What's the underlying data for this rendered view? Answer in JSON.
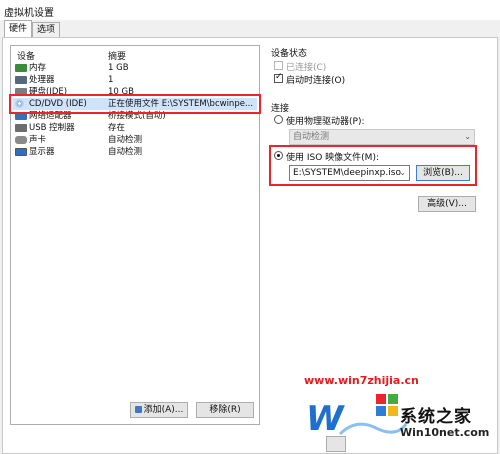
{
  "window": {
    "title": "虚拟机设置"
  },
  "tabs": [
    {
      "label": "硬件"
    },
    {
      "label": "选项"
    }
  ],
  "device_list": {
    "headers": {
      "device": "设备",
      "summary": "摘要"
    },
    "rows": [
      {
        "name": "内存",
        "summary": "1 GB",
        "icon": "memory-icon"
      },
      {
        "name": "处理器",
        "summary": "1",
        "icon": "processor-icon"
      },
      {
        "name": "硬盘(IDE)",
        "summary": "10 GB",
        "icon": "hard-disk-icon"
      },
      {
        "name": "CD/DVD (IDE)",
        "summary": "正在使用文件 E:\\SYSTEM\\bcwinpe...",
        "icon": "cd-dvd-icon"
      },
      {
        "name": "网络适配器",
        "summary": "桥接模式(自动)",
        "icon": "network-adapter-icon"
      },
      {
        "name": "USB 控制器",
        "summary": "存在",
        "icon": "usb-icon"
      },
      {
        "name": "声卡",
        "summary": "自动检测",
        "icon": "sound-card-icon"
      },
      {
        "name": "显示器",
        "summary": "自动检测",
        "icon": "display-icon"
      }
    ],
    "add_button": "添加(A)...",
    "remove_button": "移除(R)"
  },
  "device_status": {
    "label": "设备状态",
    "connected": "已连接(C)",
    "connect_at_power_on": "启动时连接(O)"
  },
  "connection": {
    "label": "连接",
    "use_physical_drive": "使用物理驱动器(P):",
    "physical_drive_value": "自动检测",
    "use_iso": "使用 ISO 映像文件(M):",
    "iso_path": "E:\\SYSTEM\\deepinxp.iso",
    "browse_button": "浏览(B)...",
    "advanced_button": "高级(V)..."
  },
  "watermark": {
    "url": "www.win7zhijia.cn",
    "brand": "系统之家",
    "brand_url": "Win10net.com"
  },
  "colors": {
    "highlight": "#e8262c",
    "selection": "#cfe3fb",
    "watermark_red": "#e51c1c"
  }
}
